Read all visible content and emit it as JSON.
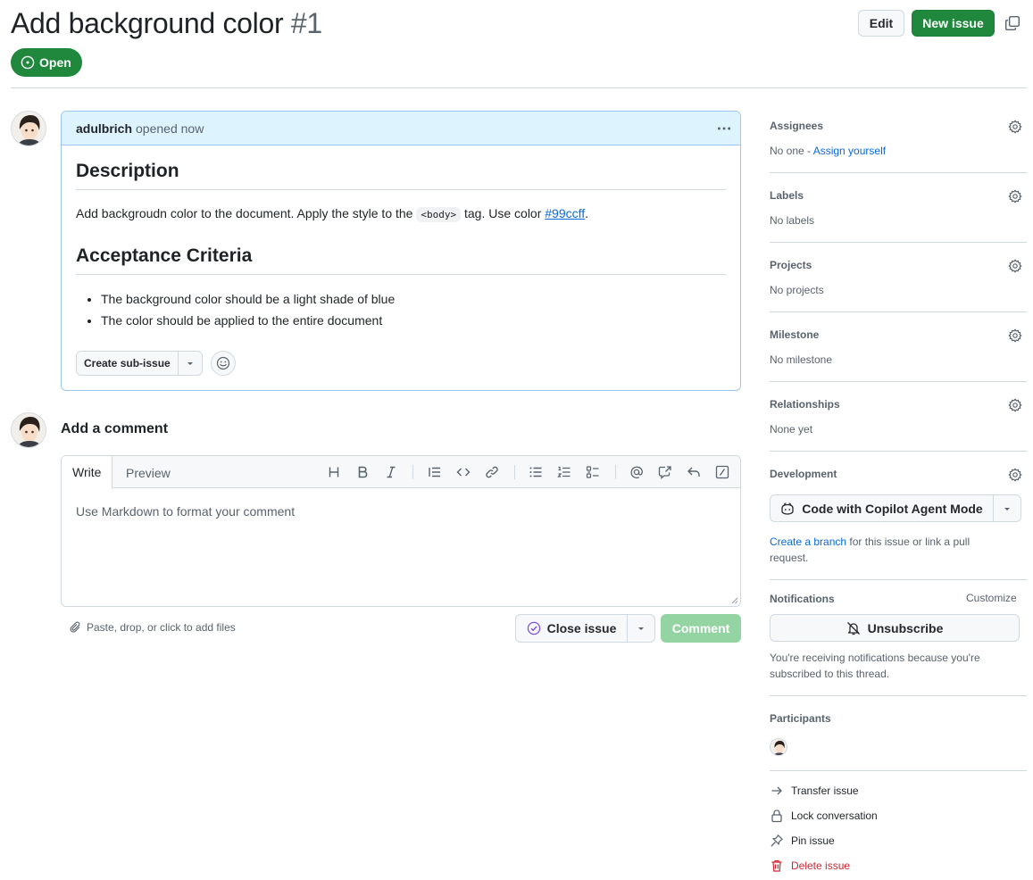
{
  "issue": {
    "title": "Add background color",
    "number": "#1",
    "state": "Open"
  },
  "header": {
    "edit_label": "Edit",
    "new_issue_label": "New issue"
  },
  "body": {
    "author": "adulbrich",
    "meta": "opened now",
    "description_heading": "Description",
    "description_text_1": "Add backgroudn color to the document. Apply the style to the ",
    "description_code": "<body>",
    "description_text_2": " tag. Use color ",
    "description_link": "#99ccff",
    "description_text_3": ".",
    "criteria_heading": "Acceptance Criteria",
    "criteria": [
      "The background color should be a light shade of blue",
      "The color should be applied to the entire document"
    ],
    "create_subissue_label": "Create sub-issue"
  },
  "composer": {
    "title": "Add a comment",
    "tab_write": "Write",
    "tab_preview": "Preview",
    "placeholder": "Use Markdown to format your comment",
    "attach_hint": "Paste, drop, or click to add files",
    "close_issue_label": "Close issue",
    "comment_label": "Comment"
  },
  "sidebar": {
    "assignees": {
      "heading": "Assignees",
      "value_prefix": "No one - ",
      "assign_link": "Assign yourself"
    },
    "labels": {
      "heading": "Labels",
      "value": "No labels"
    },
    "projects": {
      "heading": "Projects",
      "value": "No projects"
    },
    "milestone": {
      "heading": "Milestone",
      "value": "No milestone"
    },
    "relationships": {
      "heading": "Relationships",
      "value": "None yet"
    },
    "development": {
      "heading": "Development",
      "copilot_label": "Code with Copilot Agent Mode",
      "branch_link": "Create a branch",
      "branch_text_1": " for this issue or link a pull",
      "branch_text_2": "request."
    },
    "notifications": {
      "heading": "Notifications",
      "customize": "Customize",
      "unsubscribe_label": "Unsubscribe",
      "note_1": "You're receiving notifications because you're",
      "note_2": "subscribed to this thread."
    },
    "participants": {
      "heading": "Participants"
    },
    "actions": {
      "transfer": "Transfer issue",
      "lock": "Lock conversation",
      "pin": "Pin issue",
      "delete": "Delete issue"
    }
  },
  "colors": {
    "primary_green": "#1f883d",
    "link_blue": "#0969da",
    "header_bg": "#ddf4ff",
    "danger_red": "#d1242f",
    "muted_text": "#59636e"
  }
}
